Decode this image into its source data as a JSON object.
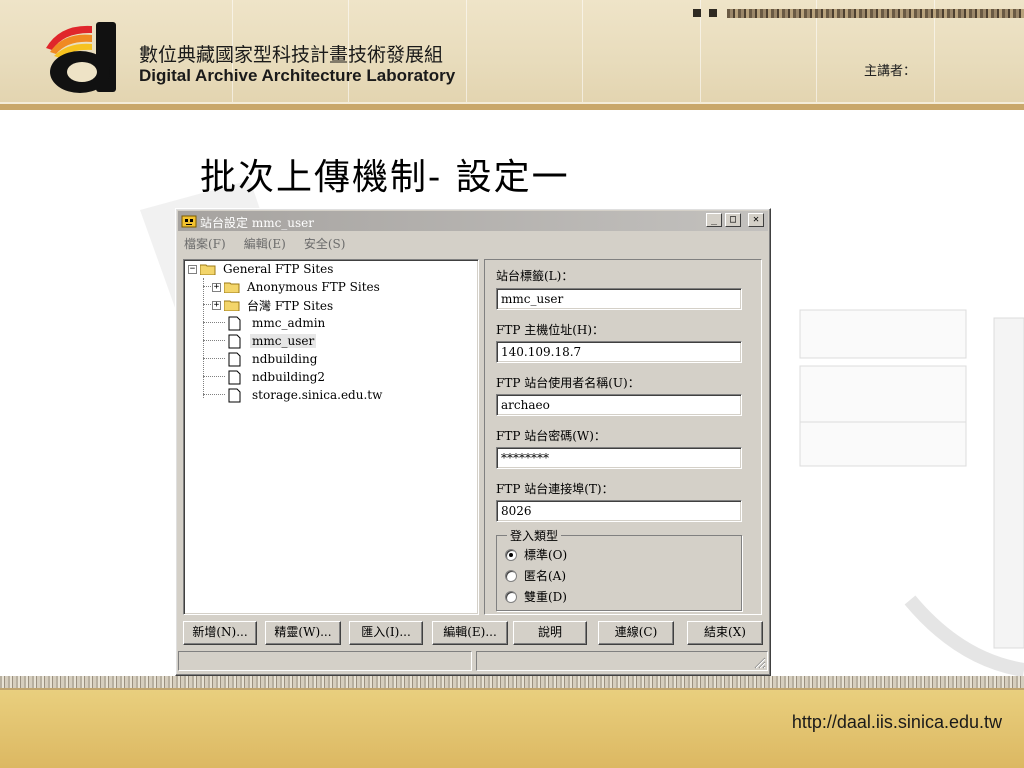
{
  "slide": {
    "org_name_zh": "數位典藏國家型科技計畫技術發展組",
    "org_name_en": "Digital Archive Architecture Laboratory",
    "speaker_label": "主講者：",
    "title": "批次上傳機制- 設定一",
    "footer_url": "http://daal.iis.sinica.edu.tw"
  },
  "window": {
    "title": "站台設定 mmc_user",
    "menu": [
      "檔案(F)",
      "編輯(E)",
      "安全(S)"
    ],
    "tree": {
      "root": "General FTP Sites",
      "children": [
        {
          "label": "Anonymous FTP Sites",
          "type": "folder"
        },
        {
          "label": "台灣 FTP Sites",
          "type": "folder"
        },
        {
          "label": "mmc_admin",
          "type": "site"
        },
        {
          "label": "mmc_user",
          "type": "site",
          "selected": true
        },
        {
          "label": "ndbuilding",
          "type": "site"
        },
        {
          "label": "ndbuilding2",
          "type": "site"
        },
        {
          "label": "storage.sinica.edu.tw",
          "type": "site"
        }
      ]
    },
    "form": {
      "site_label": {
        "label": "站台標籤(L)：",
        "value": "mmc_user"
      },
      "host": {
        "label": "FTP 主機位址(H)：",
        "value": "140.109.18.7"
      },
      "username": {
        "label": "FTP 站台使用者名稱(U)：",
        "value": "archaeo"
      },
      "password": {
        "label": "FTP 站台密碼(W)：",
        "value": "********"
      },
      "port": {
        "label": "FTP 站台連接埠(T)：",
        "value": "8026"
      },
      "login_type": {
        "legend": "登入類型",
        "options": [
          "標準(O)",
          "匿名(A)",
          "雙重(D)"
        ],
        "selected": "標準(O)"
      }
    },
    "buttons": [
      "新增(N)...",
      "精靈(W)...",
      "匯入(I)...",
      "編輯(E)...",
      "說明",
      "連線(C)",
      "結束(X)"
    ],
    "status": [
      "",
      ""
    ]
  },
  "colors": {
    "header_bg": "#e8dcbc",
    "footer_bg": "#e2c472",
    "dialog_face": "#d4d0c8",
    "titlebar_inactive": "#a6a3a0"
  }
}
